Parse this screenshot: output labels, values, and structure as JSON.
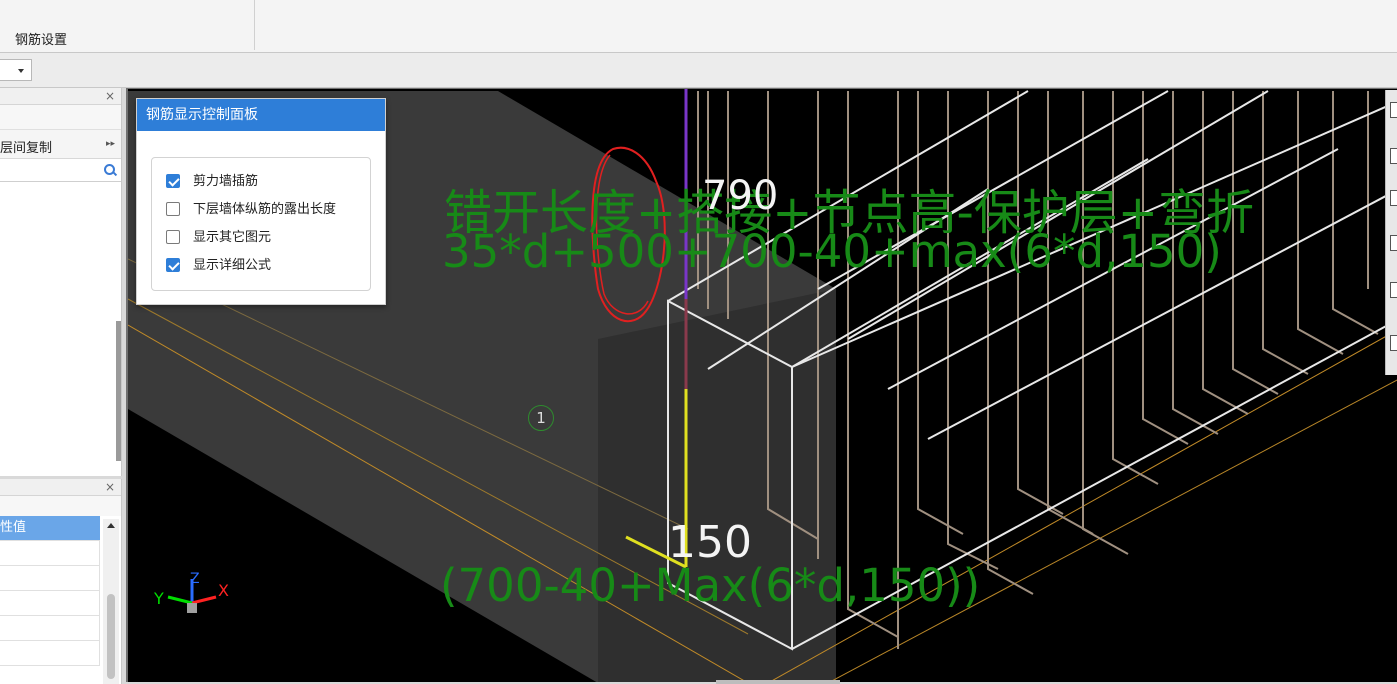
{
  "ribbon": {
    "group_label": "钢筋设置"
  },
  "left_panel_top": {
    "close": "×",
    "row_label": "层间复制",
    "row_more": "▸▸"
  },
  "left_panel_bottom": {
    "close": "×",
    "header_label": "性值"
  },
  "control_panel": {
    "title": "钢筋显示控制面板",
    "options": [
      {
        "label": "剪力墙插筋",
        "checked": true
      },
      {
        "label": "下层墙体纵筋的露出长度",
        "checked": false
      },
      {
        "label": "显示其它图元",
        "checked": false
      },
      {
        "label": "显示详细公式",
        "checked": true
      }
    ]
  },
  "viewport": {
    "formula_title": "错开长度+搭接+节点高-保护层+弯折",
    "formula_expr": "35*d+500+700-40+max(6*d,150)",
    "dimension_top": "790",
    "dimension_bottom": "150",
    "formula_bottom": "(700-40+Max(6*d,150))",
    "axis_marker": "1",
    "axis_x": "X",
    "axis_y": "Y",
    "axis_z": "Z"
  },
  "colors": {
    "accent": "#2e7ed8",
    "formula_text": "#178a17",
    "annotation": "#e02020"
  }
}
